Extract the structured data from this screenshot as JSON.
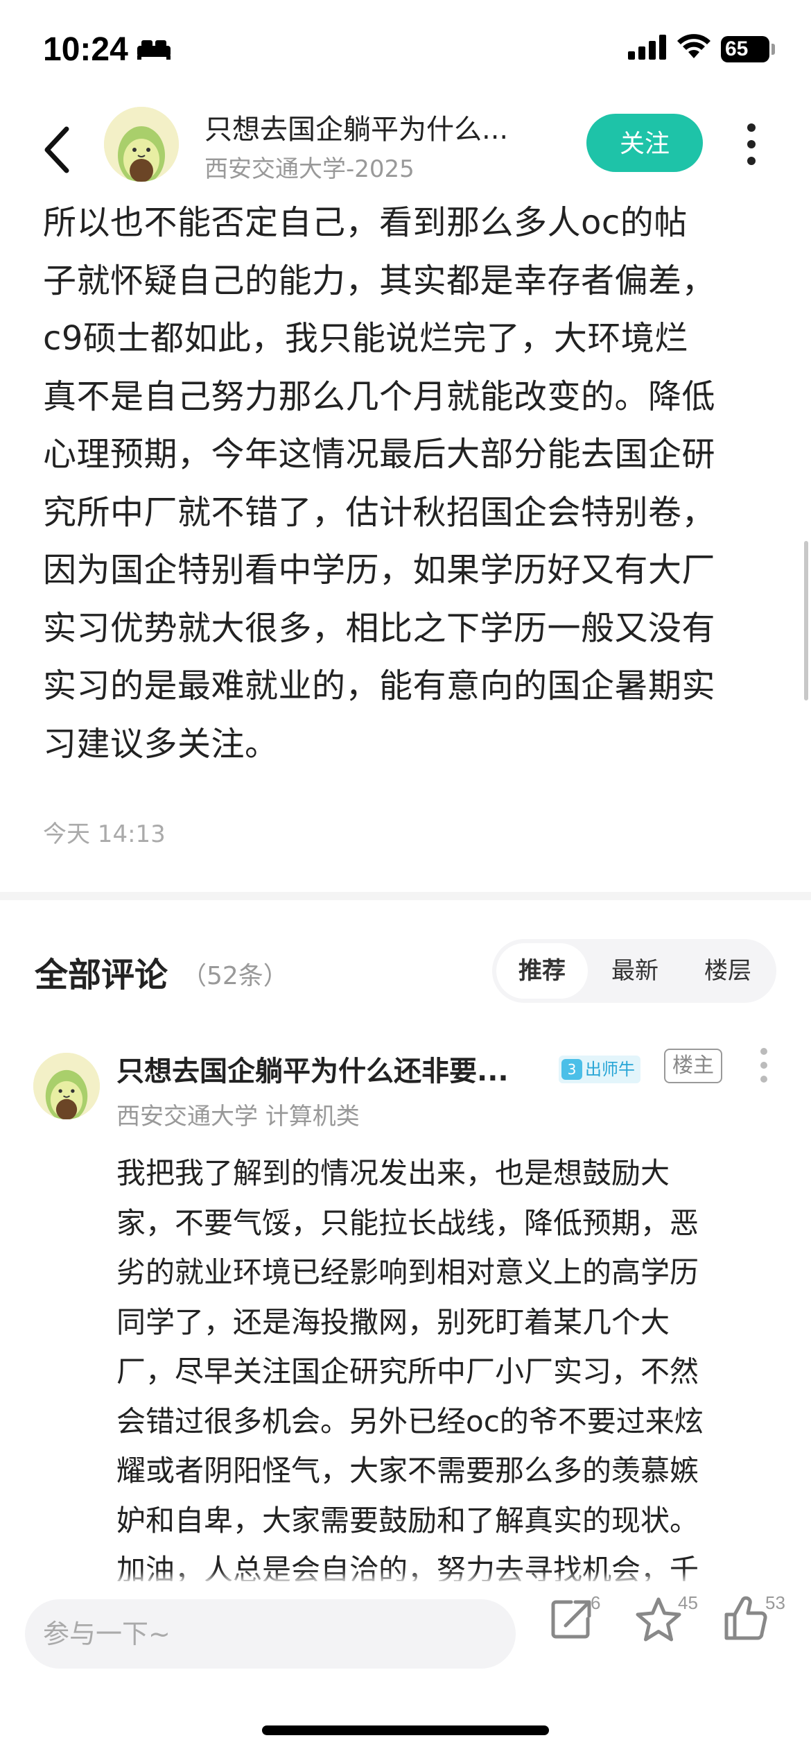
{
  "status_bar": {
    "time": "10:24",
    "battery": "65"
  },
  "header": {
    "title": "只想去国企躺平为什么...",
    "subtitle": "西安交通大学-2025",
    "follow_label": "关注"
  },
  "post": {
    "lines": [
      "所以也不能否定自己，看到那么多人oc的帖",
      "子就怀疑自己的能力，其实都是幸存者偏差，",
      "c9硕士都如此，我只能说烂完了，大环境烂",
      "真不是自己努力那么几个月就能改变的。降低",
      "心理预期，今年这情况最后大部分能去国企研",
      "究所中厂就不错了，估计秋招国企会特别卷，",
      "因为国企特别看中学历，如果学历好又有大厂",
      "实习优势就大很多，相比之下学历一般又没有",
      "实习的是最难就业的，能有意向的国企暑期实",
      "习建议多关注。"
    ],
    "time": "今天 14:13"
  },
  "comments_section": {
    "title": "全部评论",
    "count": "（52条）",
    "tabs": [
      "推荐",
      "最新",
      "楼层"
    ],
    "active_tab": "推荐"
  },
  "comment": {
    "author": "只想去国企躺平为什么还非要...",
    "level": "3",
    "level_label": "出师牛",
    "owner_badge": "楼主",
    "school": "西安交通大学  计算机类",
    "lines": [
      "我把我了解到的情况发出来，也是想鼓励大",
      "家，不要气馁，只能拉长战线，降低预期，恶",
      "劣的就业环境已经影响到相对意义上的高学历",
      "同学了，还是海投撒网，别死盯着某几个大",
      "厂，尽早关注国企研究所中厂小厂实习，不然",
      "会错过很多机会。另外已经oc的爷不要过来炫",
      "耀或者阴阳怪气，大家不需要那么多的羡慕嫉",
      "妒和自卑，大家需要鼓励和了解真实的现状。",
      "加油，人总是会自洽的，努力去寻找机会，千"
    ]
  },
  "bottom_bar": {
    "reply_placeholder": "参与一下~",
    "share_count": "6",
    "star_count": "45",
    "like_count": "53"
  },
  "colors": {
    "accent": "#1ec3a8",
    "badge_blue": "#27a5d6"
  },
  "icons": [
    "back-icon",
    "more-icon",
    "share-icon",
    "star-icon",
    "thumbs-up-icon",
    "signal-icon",
    "wifi-icon",
    "sleep-icon"
  ]
}
